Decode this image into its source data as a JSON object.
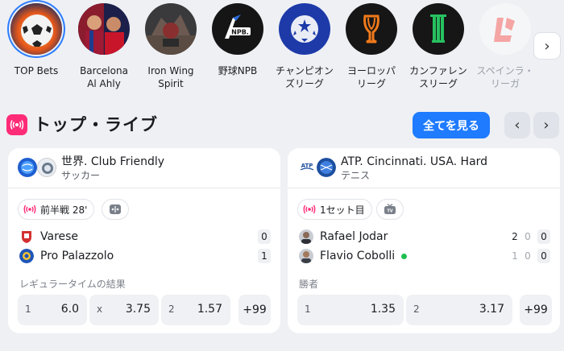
{
  "categories": [
    {
      "label": "TOP Bets",
      "selected": true
    },
    {
      "label": "Barcelona\nAl Ahly"
    },
    {
      "label": "Iron Wing\nSpirit"
    },
    {
      "label": "野球NPB"
    },
    {
      "label": "チャンピオン\nズリーグ"
    },
    {
      "label": "ヨーロッパ\nリーグ"
    },
    {
      "label": "カンファレン\nスリーグ"
    },
    {
      "label": "スペインラ・\nリーガ",
      "faded": true
    }
  ],
  "section": {
    "title": "トップ・ライブ",
    "see_all": "全てを見る"
  },
  "matches": [
    {
      "league": "世界. Club Friendly",
      "sport": "サッカー",
      "status": "前半戦 28'",
      "teams": [
        {
          "name": "Varese",
          "score": "0"
        },
        {
          "name": "Pro Palazzolo",
          "score": "1"
        }
      ],
      "market": "レギュラータイムの結果",
      "odds": [
        {
          "key": "1",
          "value": "6.0"
        },
        {
          "key": "x",
          "value": "3.75"
        },
        {
          "key": "2",
          "value": "1.57"
        }
      ],
      "more": "+99"
    },
    {
      "league": "ATP. Cincinnati. USA. Hard",
      "sport": "テニス",
      "status": "1セット目",
      "teams": [
        {
          "name": "Rafael Jodar",
          "sets": "2",
          "games": "0",
          "points": "0"
        },
        {
          "name": "Flavio Cobolli",
          "sets": "1",
          "games": "0",
          "points": "0"
        }
      ],
      "market": "勝者",
      "odds": [
        {
          "key": "1",
          "value": "1.35"
        },
        {
          "key": "2",
          "value": "3.17"
        }
      ],
      "more": "+99"
    }
  ],
  "colors": {
    "accent": "#1f7bff",
    "live": "#ff2b77",
    "serve": "#1fbf4e"
  },
  "icons": [
    "chevron-right-icon",
    "chevron-left-icon",
    "live-broadcast-icon",
    "stats-icon",
    "tv-icon"
  ]
}
